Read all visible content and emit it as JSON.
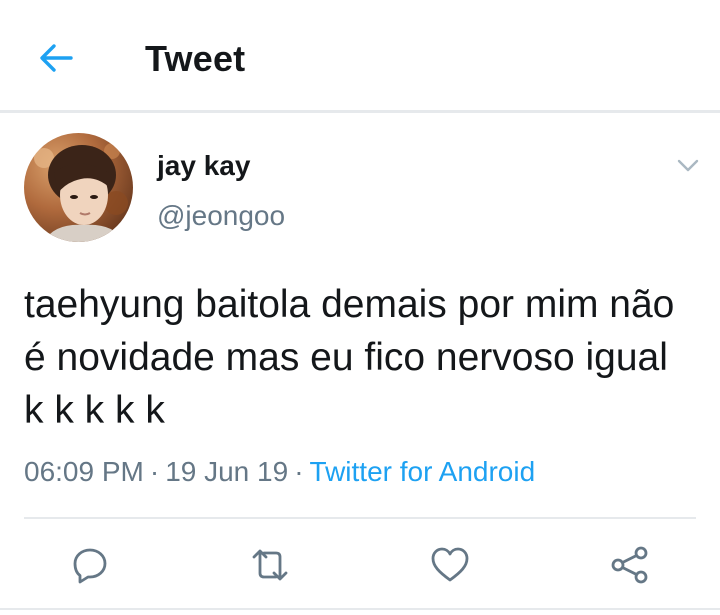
{
  "header": {
    "title": "Tweet",
    "back_icon": "arrow-left-icon"
  },
  "tweet": {
    "author": {
      "display_name": "jay kay",
      "handle": "@jeongoo"
    },
    "text": "taehyung baitola demais por mim não é novidade mas eu fico nervoso igual k k k k k",
    "time": "06:09 PM",
    "separator": "·",
    "date": "19 Jun 19",
    "source": "Twitter for Android"
  },
  "actions": {
    "reply_icon": "reply-icon",
    "retweet_icon": "retweet-icon",
    "like_icon": "heart-icon",
    "share_icon": "share-icon"
  },
  "colors": {
    "accent": "#1da1f2",
    "text": "#14171a",
    "secondary": "#657786",
    "divider": "#e6e9ec",
    "icon": "#657786"
  }
}
